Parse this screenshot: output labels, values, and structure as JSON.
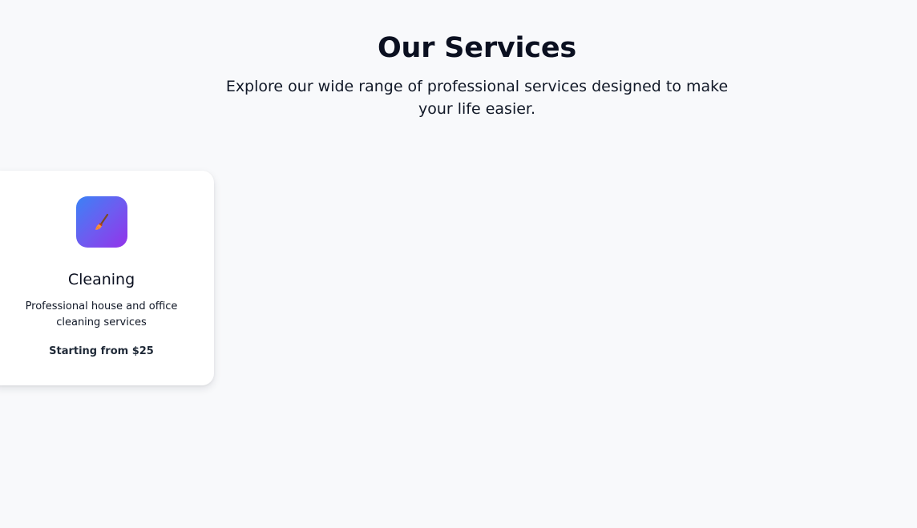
{
  "section": {
    "title": "Our Services",
    "subtitle": "Explore our wide range of professional services designed to make your life easier."
  },
  "services": [
    {
      "icon": "broom-icon",
      "name": "Cleaning",
      "description": "Professional house and office cleaning services",
      "price": "Starting from $25"
    }
  ],
  "colors": {
    "background": "#f8f9fb",
    "card": "#ffffff",
    "icon_gradient_start": "#3b82f6",
    "icon_gradient_end": "#9333ea",
    "title_text": "#0b1020"
  }
}
